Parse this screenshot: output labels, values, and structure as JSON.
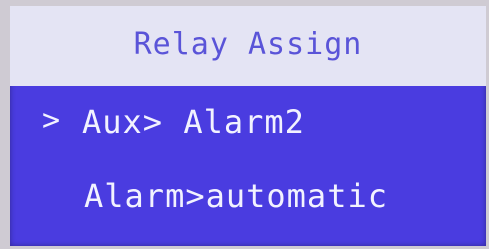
{
  "screen": {
    "title": "Relay Assign",
    "cursor": ">",
    "items": [
      {
        "label": "Aux> Alarm2"
      },
      {
        "label": "Alarm>automatic"
      }
    ]
  },
  "colors": {
    "lcd_background": "#4a3ce0",
    "header_background": "#e4e4f4",
    "title_text": "#5a54d8",
    "item_text": "#f2f2ff"
  }
}
